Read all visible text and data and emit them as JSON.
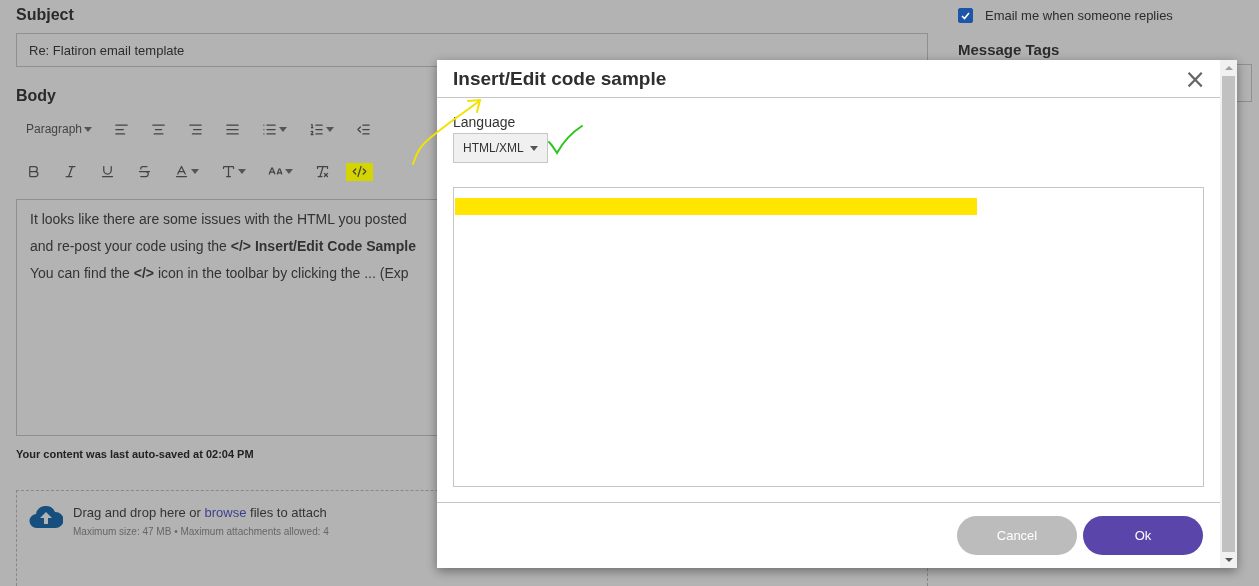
{
  "subject": {
    "label": "Subject",
    "value": "Re: Flatiron email  template"
  },
  "body": {
    "label": "Body",
    "toolbar_rows": [
      [
        {
          "kind": "select",
          "label": "Paragraph"
        },
        {
          "kind": "button",
          "dropdown": false,
          "highlighted": false
        },
        {
          "kind": "button",
          "dropdown": false,
          "highlighted": false
        },
        {
          "kind": "button",
          "dropdown": false,
          "highlighted": false
        },
        {
          "kind": "button",
          "dropdown": false,
          "highlighted": false
        },
        {
          "kind": "button",
          "dropdown": true,
          "highlighted": false
        },
        {
          "kind": "button",
          "dropdown": true,
          "highlighted": false
        },
        {
          "kind": "button",
          "dropdown": false,
          "highlighted": false
        }
      ],
      [
        {
          "kind": "button",
          "dropdown": false,
          "highlighted": false
        },
        {
          "kind": "button",
          "dropdown": false,
          "highlighted": false
        },
        {
          "kind": "button",
          "dropdown": false,
          "highlighted": false
        },
        {
          "kind": "button",
          "dropdown": false,
          "highlighted": false
        },
        {
          "kind": "button",
          "dropdown": true,
          "highlighted": false
        },
        {
          "kind": "button",
          "dropdown": true,
          "highlighted": false
        },
        {
          "kind": "button",
          "dropdown": true,
          "highlighted": false
        },
        {
          "kind": "button",
          "dropdown": false,
          "highlighted": false
        },
        {
          "kind": "button",
          "dropdown": false,
          "highlighted": true
        }
      ]
    ],
    "lines": [
      "It looks like there are some issues with the HTML you posted",
      "and re-post your code using the **</> Insert/Edit Code Sample**",
      "You can find the **</>** icon in the toolbar by clicking the ... (Exp"
    ],
    "autosave": "Your content was last auto-saved at 02:04 PM"
  },
  "attach": {
    "before": "Drag and drop here or",
    "link": "browse",
    "after": "files to attach",
    "limits": "Maximum size: 47 MB • Maximum attachments allowed: 4"
  },
  "notify": {
    "label": "Email me when someone replies",
    "checked": true
  },
  "tags": {
    "label": "Message Tags"
  },
  "dialog": {
    "title": "Insert/Edit code sample",
    "close": "×",
    "language_label": "Language",
    "language": "HTML/XML",
    "buttons": [
      {
        "kind": "secondary",
        "label": "Cancel"
      },
      {
        "kind": "primary",
        "label": "Ok"
      }
    ]
  },
  "annotations": [
    {
      "kind": "arrow"
    },
    {
      "kind": "check"
    },
    {
      "kind": "highlight"
    }
  ]
}
